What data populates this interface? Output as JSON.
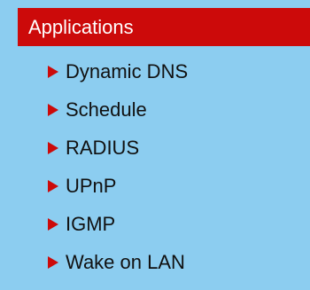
{
  "header": {
    "title": "Applications"
  },
  "menu": {
    "items": [
      {
        "label": "Dynamic DNS",
        "icon": "arrow-right-icon"
      },
      {
        "label": "Schedule",
        "icon": "arrow-right-icon"
      },
      {
        "label": "RADIUS",
        "icon": "arrow-right-icon"
      },
      {
        "label": "UPnP",
        "icon": "arrow-right-icon"
      },
      {
        "label": "IGMP",
        "icon": "arrow-right-icon"
      },
      {
        "label": "Wake on LAN",
        "icon": "arrow-right-icon"
      }
    ]
  },
  "colors": {
    "background": "#8ccdf0",
    "header": "#cc0a0a",
    "accent": "#cc0a0a",
    "header_text": "#ffffff",
    "item_text": "#111111"
  }
}
